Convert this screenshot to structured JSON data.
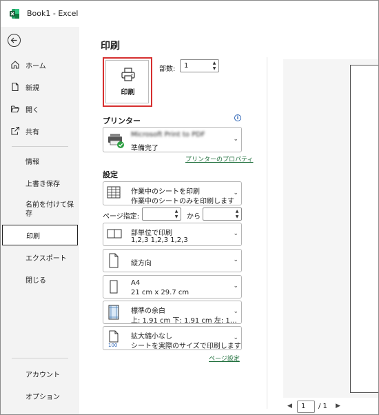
{
  "app": {
    "title": "Book1  -  Excel"
  },
  "sidebar": {
    "back_icon": "arrow-left-circle-icon",
    "items": [
      {
        "label": "ホーム",
        "icon": "home-icon"
      },
      {
        "label": "新規",
        "icon": "new-document-icon"
      },
      {
        "label": "開く",
        "icon": "folder-open-icon"
      },
      {
        "label": "共有",
        "icon": "share-icon"
      }
    ],
    "sub_items": [
      {
        "label": "情報"
      },
      {
        "label": "上書き保存"
      },
      {
        "label": "名前を付けて保存"
      },
      {
        "label": "印刷",
        "active": true
      },
      {
        "label": "エクスポート"
      },
      {
        "label": "閉じる"
      }
    ],
    "bottom_items": [
      {
        "label": "アカウント"
      },
      {
        "label": "オプション"
      }
    ]
  },
  "main": {
    "title": "印刷",
    "print_button_label": "印刷",
    "copies_label": "部数:",
    "copies_value": "1",
    "printer_heading": "プリンター",
    "printer_name": "Microsoft Print to PDF",
    "printer_status": "準備完了",
    "printer_properties_link": "プリンターのプロパティ",
    "settings_heading": "設定",
    "settings": {
      "scope": {
        "line1": "作業中のシートを印刷",
        "line2": "作業中のシートのみを印刷します"
      },
      "pages_label": "ページ指定:",
      "pages_to": "から",
      "collate": {
        "line1": "部単位で印刷",
        "line2": "1,2,3    1,2,3    1,2,3"
      },
      "orientation": {
        "line1": "縦方向"
      },
      "paper": {
        "line1": "A4",
        "line2": "21 cm x 29.7 cm"
      },
      "margins": {
        "line1": "標準の余白",
        "line2": "上: 1.91 cm 下: 1.91 cm 左: 1…"
      },
      "scaling": {
        "line1": "拡大縮小なし",
        "line2": "シートを実際のサイズで印刷します"
      }
    },
    "page_setup_link": "ページ設定"
  },
  "preview": {
    "current_page": "1",
    "total_pages": "/ 1"
  },
  "colors": {
    "accent_red": "#d62f2f",
    "link_green": "#1e6e3b",
    "excel_green": "#1d6f42"
  }
}
